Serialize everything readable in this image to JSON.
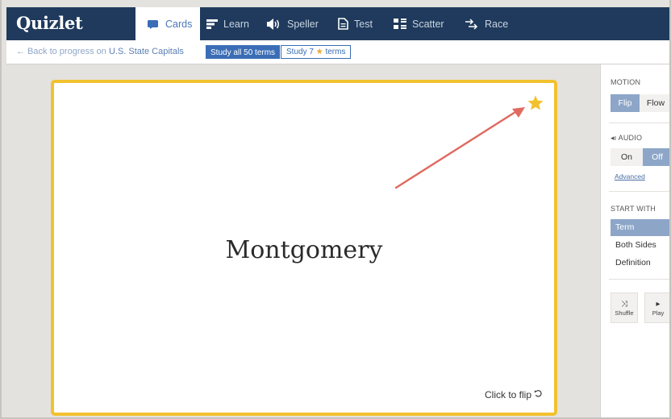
{
  "app": {
    "logo": "Quizlet"
  },
  "tabs": [
    {
      "label": "Cards",
      "icon": "cards-icon",
      "active": true
    },
    {
      "label": "Learn",
      "icon": "learn-icon"
    },
    {
      "label": "Speller",
      "icon": "speaker-icon"
    },
    {
      "label": "Test",
      "icon": "document-icon"
    },
    {
      "label": "Scatter",
      "icon": "scatter-grid-icon"
    },
    {
      "label": "Race",
      "icon": "race-arrows-icon"
    }
  ],
  "breadcrumb": {
    "back_text": "← Back to progress on",
    "subject": "U.S. State Capitals",
    "study_all_label": "Study all 50 terms",
    "study_starred_prefix": "Study 7",
    "study_starred_suffix": "terms"
  },
  "card": {
    "term": "Montgomery",
    "flip_hint": "Click to flip"
  },
  "panel": {
    "motion": {
      "title": "MOTION",
      "options": [
        "Flip",
        "Flow"
      ],
      "selected": "Flip"
    },
    "audio": {
      "title": "AUDIO",
      "options": [
        "On",
        "Off"
      ],
      "selected": "Off",
      "advanced": "Advanced"
    },
    "start_with": {
      "title": "START WITH",
      "options": [
        "Term",
        "Both Sides",
        "Definition"
      ],
      "selected": "Term"
    },
    "actions": [
      {
        "label": "Shuffle",
        "icon": "shuffle-icon"
      },
      {
        "label": "Play",
        "icon": "play-icon"
      }
    ]
  },
  "colors": {
    "header": "#1f3a5c",
    "accent": "#3a6db5",
    "card_border": "#f2c12f",
    "star": "#f2c12f",
    "annotation_arrow": "#e06a5f",
    "selected_option": "#8da6c8"
  }
}
